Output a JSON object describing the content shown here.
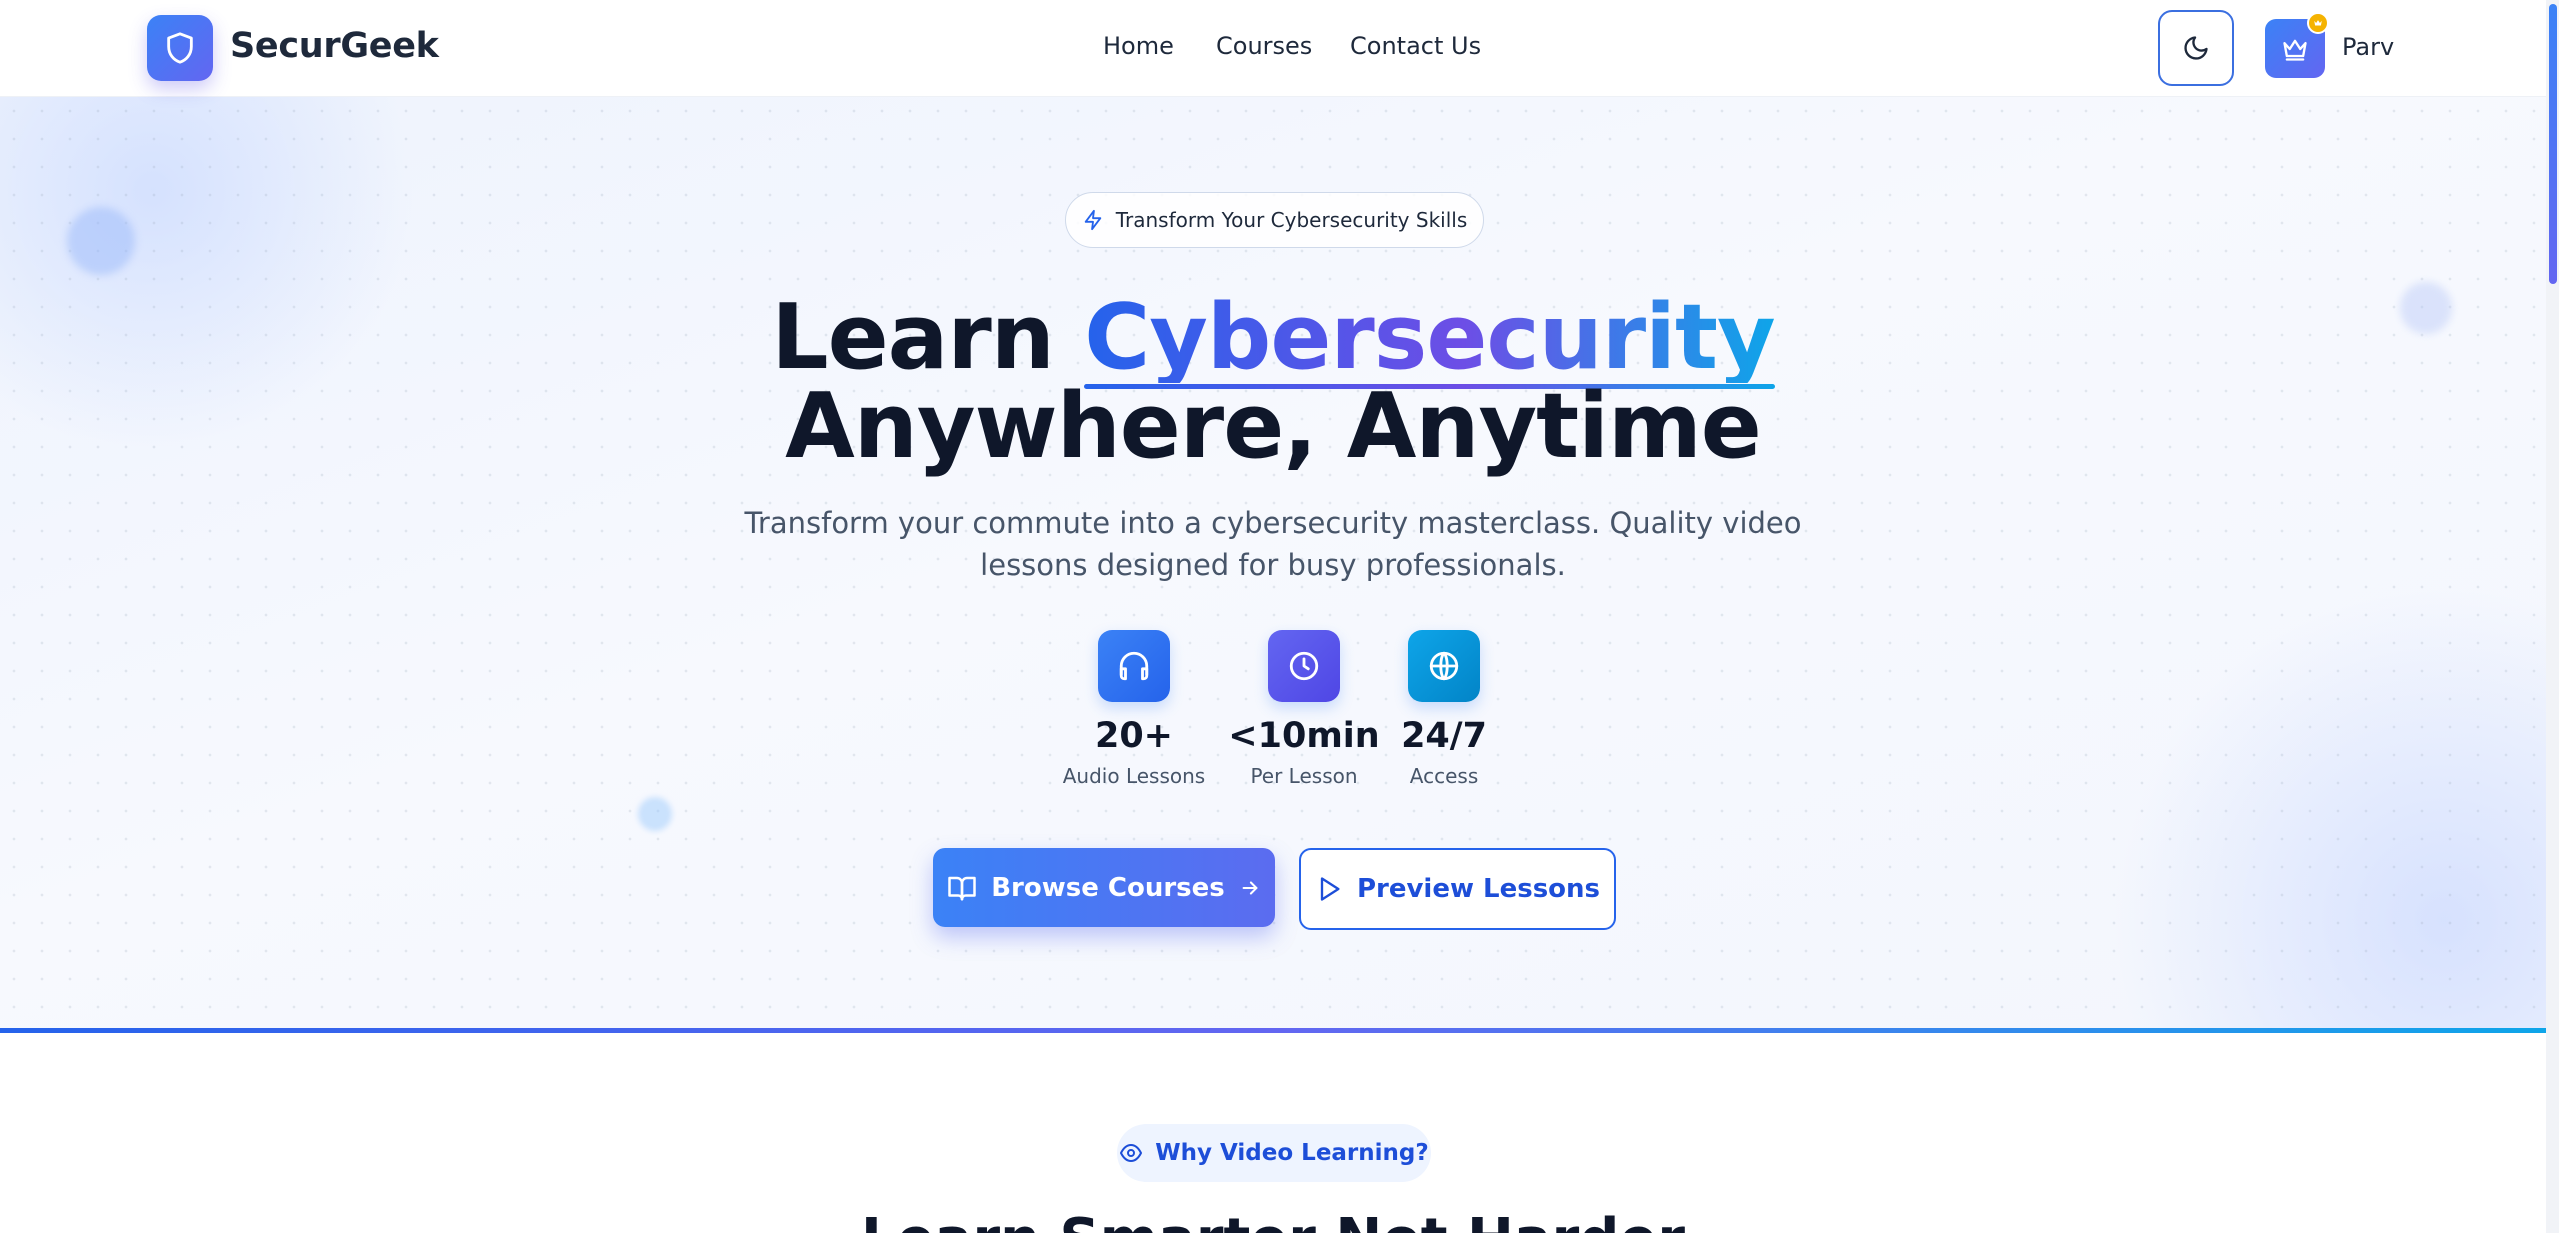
{
  "header": {
    "brand": "SecurGeek",
    "nav": [
      "Home",
      "Courses",
      "Contact Us"
    ],
    "user_name": "Parv",
    "icons": {
      "logo": "shield-icon",
      "theme_toggle": "moon-icon",
      "avatar": "crown-icon"
    }
  },
  "hero": {
    "badge": "Transform Your Cybersecurity Skills",
    "headline_prefix": "Learn ",
    "headline_highlight": "Cybersecurity",
    "headline_line2": "Anywhere, Anytime",
    "subtitle": "Transform your commute into a cybersecurity masterclass. Quality video lessons designed for busy professionals.",
    "stats": [
      {
        "value": "20+",
        "label": "Audio Lessons",
        "icon": "headphones-icon"
      },
      {
        "value": "<10min",
        "label": "Per Lesson",
        "icon": "clock-icon"
      },
      {
        "value": "24/7",
        "label": "Access",
        "icon": "globe-icon"
      }
    ],
    "primary_cta": "Browse Courses",
    "secondary_cta": "Preview Lessons"
  },
  "section2": {
    "badge": "Why Video Learning?",
    "title": "Learn Smarter Not Harder"
  },
  "colors": {
    "accent": "#2563eb",
    "accent_purple": "#6366f1",
    "accent_cyan": "#0ea5e9",
    "premium": "#f5b301",
    "text": "#0f172a"
  }
}
